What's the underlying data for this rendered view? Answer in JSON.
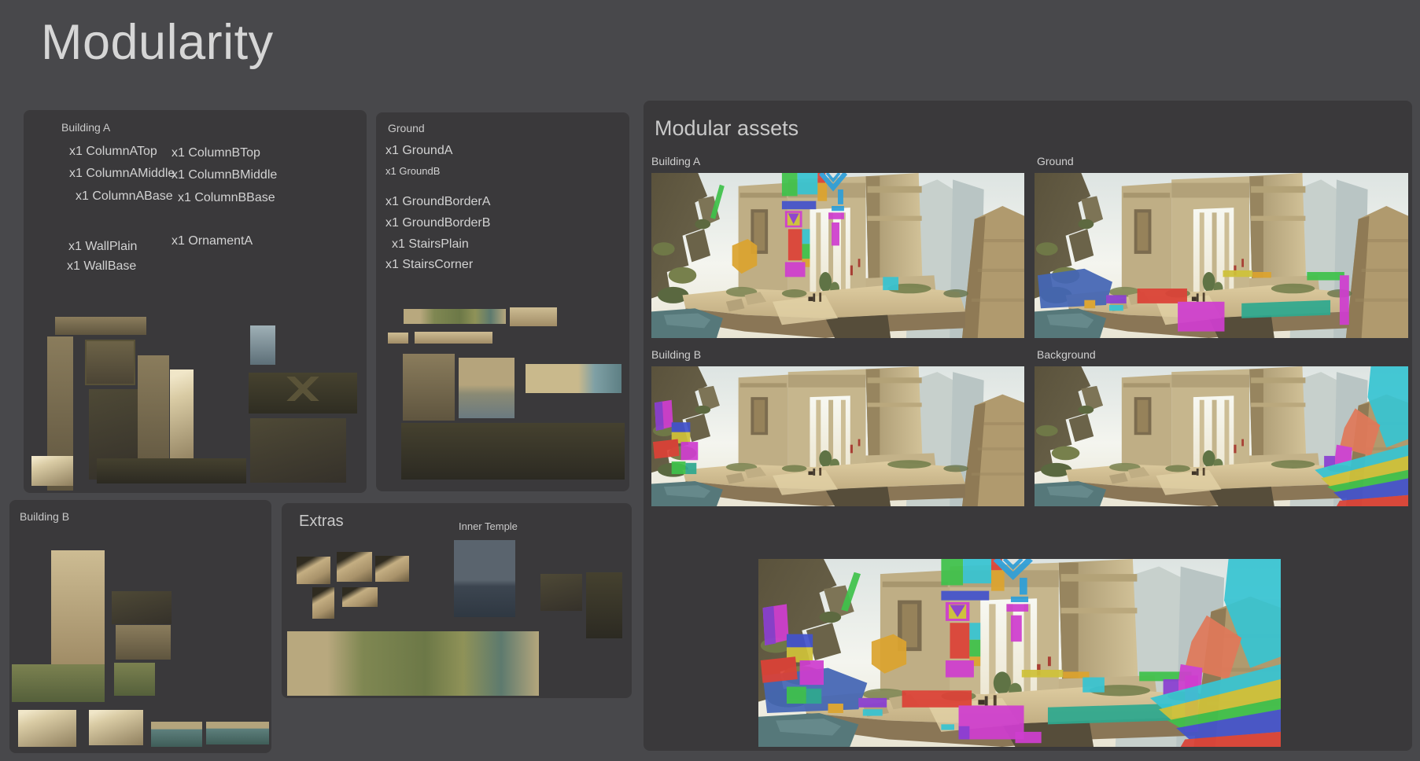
{
  "title": "Modularity",
  "palette": {
    "background": "#48484b",
    "panel": "#3a393b",
    "title_text": "#d6d6d6",
    "header_text": "#c9c9c9",
    "item_text": "#d2d2d2",
    "label_text": "#cfcfcf",
    "overlay_green": "#3fc24b",
    "overlay_red": "#dc4237",
    "overlay_cyan": "#38c4d2",
    "overlay_skyblue": "#2e9fd9",
    "overlay_orange": "#dca42f",
    "overlay_blue": "#4353cc",
    "overlay_magenta": "#cf3ecf",
    "overlay_purple": "#8a3fd2",
    "overlay_yellow": "#cfc23a",
    "overlay_teal": "#2fa98f",
    "overlay_coral": "#e0795a",
    "overlay_water": "#4466b5"
  },
  "building_a": {
    "label": "Building A",
    "col1": [
      "x1 ColumnATop",
      "x1 ColumnAMiddle",
      "x1 ColumnABase"
    ],
    "col2": [
      "x1 ColumnBTop",
      "x1 ColumnBMiddle",
      "x1 ColumnBBase"
    ],
    "wall": [
      "x1 WallPlain",
      "x1 WallBase"
    ],
    "ornament": "x1 OrnamentA"
  },
  "ground": {
    "label": "Ground",
    "items": [
      {
        "text": "x1 GroundA"
      },
      {
        "text": "x1 GroundB"
      },
      {
        "text": "x1 GroundBorderA"
      },
      {
        "text": "x1 GroundBorderB"
      },
      {
        "text": "x1 StairsPlain"
      },
      {
        "text": "x1 StairsCorner"
      }
    ]
  },
  "building_b": {
    "label": "Building B"
  },
  "extras": {
    "label": "Extras",
    "inner_temple": "Inner Temple"
  },
  "modular_assets": {
    "label": "Modular assets",
    "image_labels": [
      "Building A",
      "Ground",
      "Building B",
      "Background"
    ]
  }
}
